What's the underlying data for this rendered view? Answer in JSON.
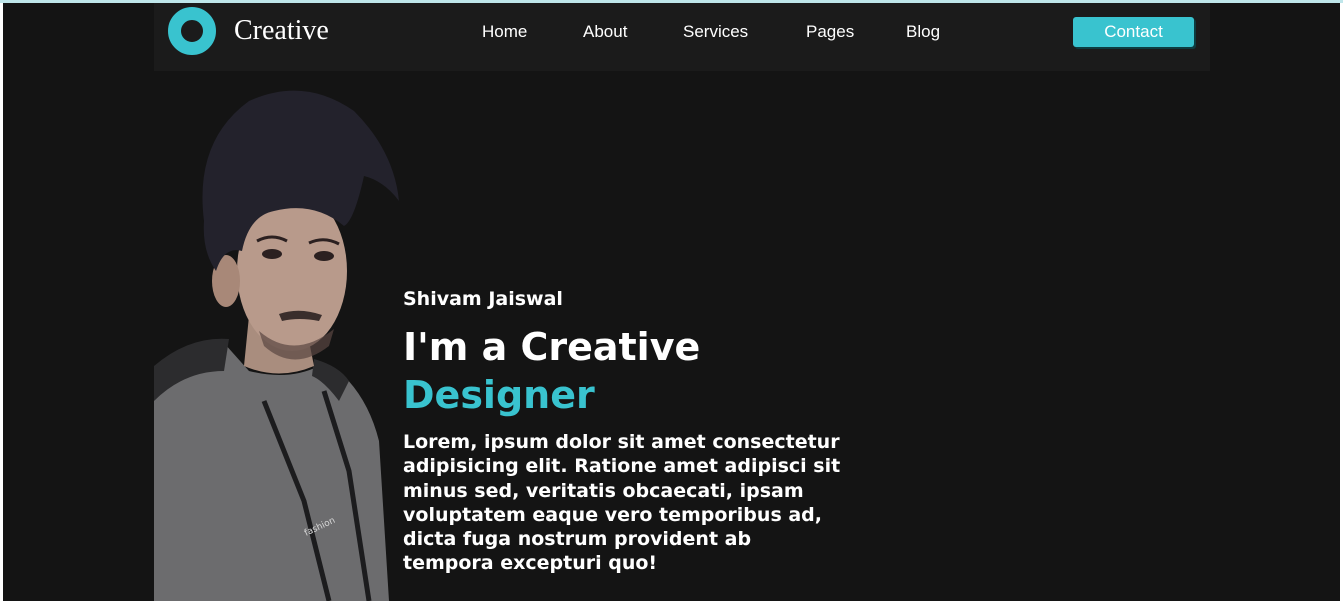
{
  "nav": {
    "brand": "Creative",
    "links": [
      "Home",
      "About",
      "Services",
      "Pages",
      "Blog"
    ],
    "contact_label": "Contact"
  },
  "hero": {
    "name": "Shivam Jaiswal",
    "title_line1": "I'm a Creative",
    "title_line2": "Designer",
    "description": "Lorem, ipsum dolor sit amet consectetur adipisicing elit. Ratione amet adipisci sit minus sed, veritatis obcaecati, ipsam voluptatem eaque vero temporibus ad, dicta fuga nostrum provident ab tempora excepturi quo!"
  },
  "colors": {
    "accent": "#39c3cf",
    "background": "#141414",
    "navbar": "#1b1b1b",
    "text": "#ffffff"
  },
  "icons": {
    "logo": "ring-logo-icon"
  }
}
